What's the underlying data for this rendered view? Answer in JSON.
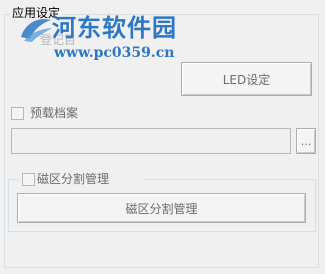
{
  "panel": {
    "title": "应用设定",
    "item_behind_watermark": "登记目",
    "led_button_label": "LED设定",
    "preload_checkbox_label": "预载档案",
    "browse_button_label": "...",
    "file_path_value": "",
    "disk_group_label": "磁区分割管理",
    "disk_button_label": "磁区分割管理"
  },
  "watermark": {
    "title": "河东软件园",
    "url": "www.pc0359.cn",
    "color": "#2d77c4"
  },
  "colors": {
    "background": "#f0f0f0",
    "disabled_text": "#6d6d6d",
    "group_border": "#d5dfe5"
  }
}
